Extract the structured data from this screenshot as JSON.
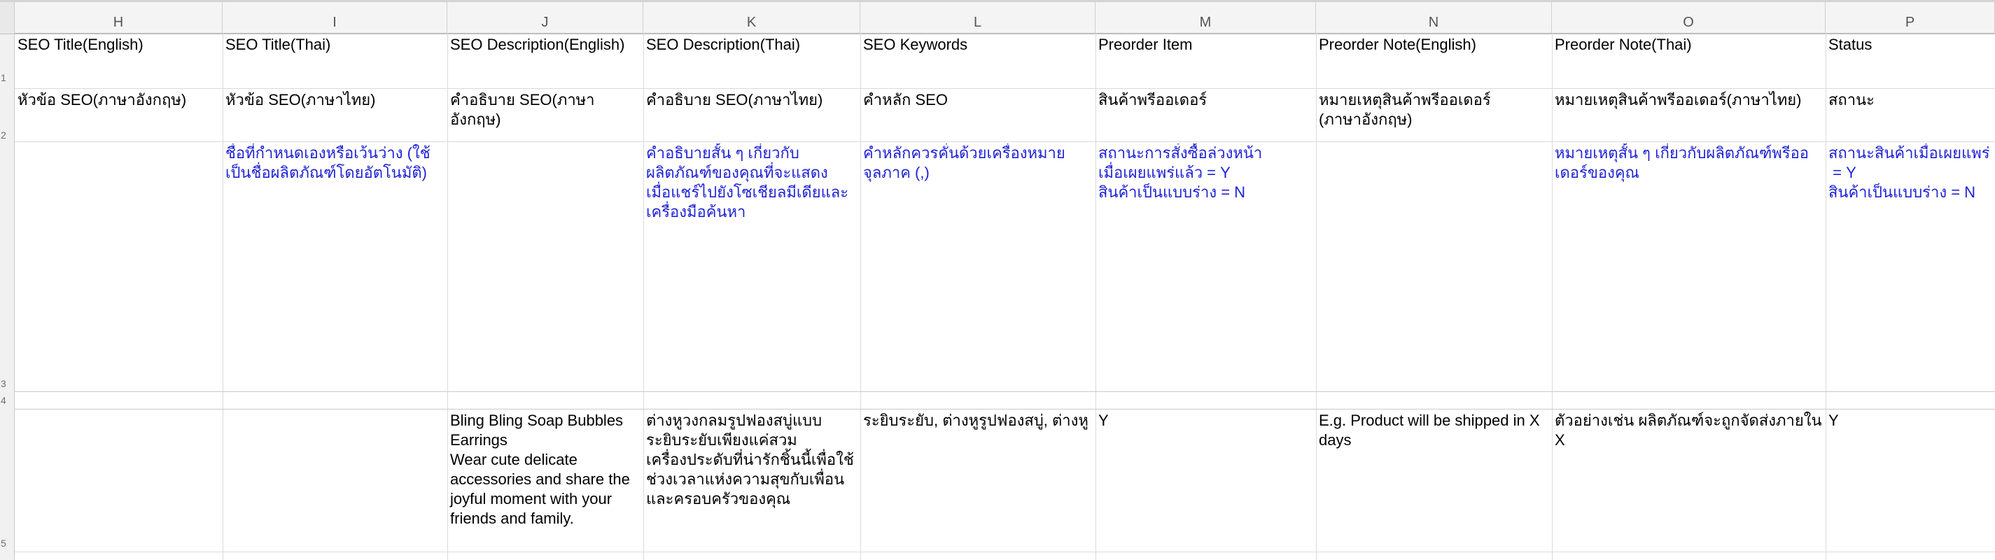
{
  "sheet": {
    "columns": [
      "H",
      "I",
      "J",
      "K",
      "L",
      "M",
      "N",
      "O",
      "P"
    ],
    "row_numbers": [
      "1",
      "2",
      "3",
      "4",
      "5"
    ],
    "rows": [
      [
        "SEO Title(English)",
        "SEO Title(Thai)",
        "SEO Description(English)",
        "SEO Description(Thai)",
        "SEO Keywords",
        "Preorder Item",
        "Preorder Note(English)",
        "Preorder Note(Thai)",
        "Status"
      ],
      [
        "หัวข้อ SEO(ภาษาอังกฤษ)",
        "หัวข้อ SEO(ภาษาไทย)",
        "คำอธิบาย SEO(ภาษาอังกฤษ)",
        "คำอธิบาย SEO(ภาษาไทย)",
        "คำหลัก SEO",
        "สินค้าพรีออเดอร์",
        "หมายเหตุสินค้าพรีออเดอร์\n(ภาษาอังกฤษ)",
        "หมายเหตุสินค้าพรีออเดอร์(ภาษาไทย)",
        "สถานะ"
      ],
      [
        "",
        "ชื่อที่กำหนดเองหรือเว้นว่าง (ใช้\nเป็นชื่อผลิตภัณฑ์โดยอัตโนมัติ)",
        "",
        "คำอธิบายสั้น ๆ เกี่ยวกับ\nผลิตภัณฑ์ของคุณที่จะแสดง\nเมื่อแชร์ไปยังโซเชียลมีเดียและ\nเครื่องมือค้นหา",
        "คำหลักควรคั่นด้วยเครื่องหมาย\nจุลภาค (,)",
        "สถานะการสั่งซื้อล่วงหน้า\nเมื่อเผยแพร่แล้ว = Y\nสินค้าเป็นแบบร่าง = N",
        "",
        "หมายเหตุสั้น ๆ เกี่ยวกับผลิตภัณฑ์พรีออ\nเดอร์ของคุณ",
        "สถานะสินค้าเมื่อเผยแพร่\n = Y\nสินค้าเป็นแบบร่าง = N"
      ],
      [
        "",
        "",
        "",
        "",
        "",
        "",
        "",
        "",
        ""
      ],
      [
        "",
        "",
        "Bling Bling Soap Bubbles\nEarrings\nWear cute delicate\naccessories and share the\njoyful moment with your\nfriends and family.",
        "ต่างหูวงกลมรูปฟองสบู่แบบ\nระยิบระยับเพียงแค่สวม\nเครื่องประดับที่น่ารักชิ้นนี้เพื่อใช้\nช่วงเวลาแห่งความสุขกับเพื่อน\nและครอบครัวของคุณ",
        "ระยิบระยับ, ต่างหูรูปฟองสบู่, ต่างหู",
        "Y",
        "E.g. Product will be shipped in X\ndays",
        "ตัวอย่างเช่น ผลิตภัณฑ์จะถูกจัดส่งภายใน X",
        "Y"
      ]
    ],
    "note_color": "#1f23d6",
    "grid_color": "#dadada"
  }
}
